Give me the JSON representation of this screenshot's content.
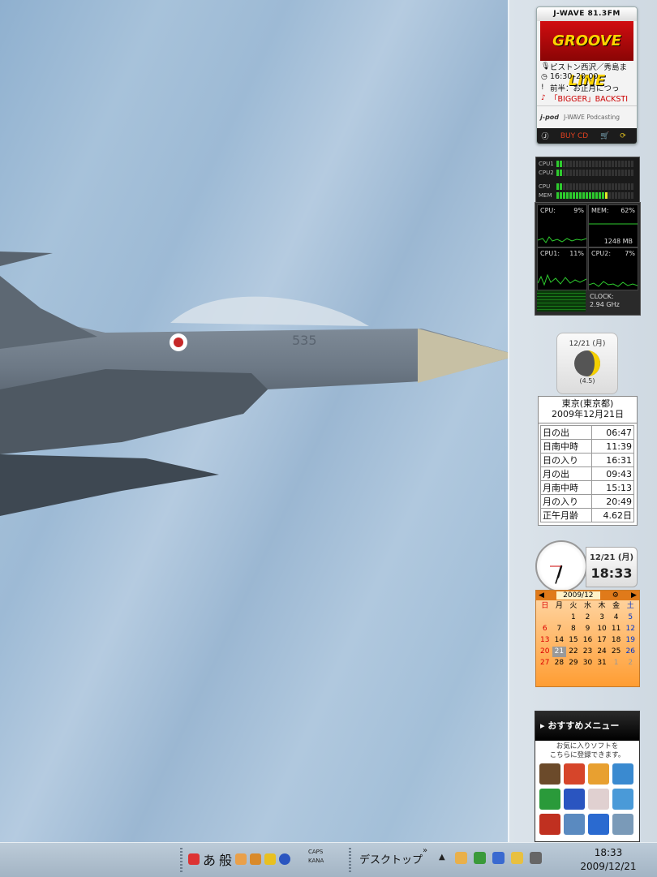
{
  "radio": {
    "station": "J-WAVE 81.3FM",
    "program": "GROOVE LINE",
    "rows": [
      {
        "icon": "microphone-icon",
        "glyph": "🎙",
        "text": "ピストン西沢／秀島ま"
      },
      {
        "icon": "clock-icon",
        "glyph": "◷",
        "text": "16:30–20:00"
      },
      {
        "icon": "exclamation-icon",
        "glyph": "!",
        "text": "前半：お正月につっ"
      },
      {
        "icon": "music-note-icon",
        "glyph": "♪",
        "text": "「BIGGER」BACKSTI"
      }
    ],
    "podcast_logo": "j-pod",
    "podcast_label": "J-WAVE Podcasting",
    "buy_cd": "BUY CD"
  },
  "meter": {
    "rows": [
      {
        "label": "CPU1",
        "on": 2,
        "yellow": 0
      },
      {
        "label": "CPU2",
        "on": 2,
        "yellow": 0
      },
      {
        "label": "CPU",
        "on": 2,
        "yellow": 0
      },
      {
        "label": "MEM",
        "on": 15,
        "yellow": 1
      }
    ],
    "cells": 24
  },
  "cpu_graph": {
    "cpu_label": "CPU:",
    "cpu_value": "9%",
    "mem_label": "MEM:",
    "mem_value": "62%",
    "mem_size": "1248 MB",
    "cpu1_label": "CPU1:",
    "cpu1_value": "11%",
    "cpu2_label": "CPU2:",
    "cpu2_value": "7%",
    "clock_label": "CLOCK:",
    "clock_value": "2.94 GHz"
  },
  "moon": {
    "date": "12/21 (月)",
    "age": "(4.5)"
  },
  "sun_table": {
    "location": "東京(東京都)",
    "date": "2009年12月21日",
    "rows": [
      {
        "label": "日の出",
        "value": "06:47"
      },
      {
        "label": "日南中時",
        "value": "11:39"
      },
      {
        "label": "日の入り",
        "value": "16:31"
      },
      {
        "label": "月の出",
        "value": "09:43"
      },
      {
        "label": "月南中時",
        "value": "15:13"
      },
      {
        "label": "月の入り",
        "value": "20:49"
      },
      {
        "label": "正午月齢",
        "value": "4.62日"
      }
    ]
  },
  "clock": {
    "date": "12/21 (月)",
    "time": "18:33",
    "hour": 18,
    "minute": 33
  },
  "calendar": {
    "month": "2009/12",
    "weekdays": [
      "日",
      "月",
      "火",
      "水",
      "木",
      "金",
      "土"
    ],
    "first_weekday": 2,
    "days": 31,
    "today": 21,
    "trailing": [
      1,
      2
    ]
  },
  "osusume": {
    "title": "おすすめメニュー",
    "hint_line1": "お気に入りソフトを",
    "hint_line2": "こちらに登録できます。",
    "icon_colors": [
      "#6b4a2a",
      "#d6452a",
      "#e8a030",
      "#3a8ad0",
      "#2a9a3a",
      "#2a55c0",
      "#e0d0d0",
      "#4a9ad8",
      "#c03020",
      "#5a8ac0",
      "#2a6ad0",
      "#7a9ab8"
    ]
  },
  "taskbar": {
    "ime_a": "あ",
    "ime_mode": "般",
    "caps": "CAPS",
    "kana": "KANA",
    "desktop": "デスクトップ",
    "chevron": "»",
    "time": "18:33",
    "date": "2009/12/21",
    "tray_colors": [
      "#e9b04a",
      "#3a9a3a",
      "#3a6ad0",
      "#e8c040",
      "#666666"
    ]
  }
}
